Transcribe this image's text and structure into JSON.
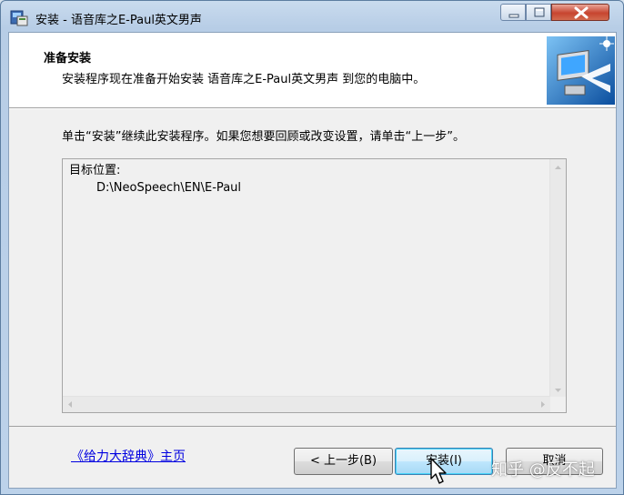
{
  "window": {
    "title": "安装 - 语音库之E-Paul英文男声",
    "controls": {
      "minimize": "minimize-icon",
      "maximize": "maximize-icon",
      "close": "close-icon"
    }
  },
  "header": {
    "title": "准备安装",
    "subtitle": "安装程序现在准备开始安装 语音库之E-Paul英文男声 到您的电脑中。",
    "image": "computer-install-icon"
  },
  "instruction": "单击“安装”继续此安装程序。如果您想要回顾或改变设置，请单击“上一步”。",
  "memo": {
    "label": "目标位置:",
    "value": "D:\\NeoSpeech\\EN\\E-Paul"
  },
  "footer": {
    "link": "《给力大辞典》主页",
    "back_button": "< 上一步(B)",
    "install_button": "安装(I)",
    "cancel_button": "取消"
  },
  "watermark": "知乎 @反不起",
  "colors": {
    "link": "#0000e0",
    "install_button_border": "#3c7fb1",
    "close_button": "#c7442f"
  }
}
